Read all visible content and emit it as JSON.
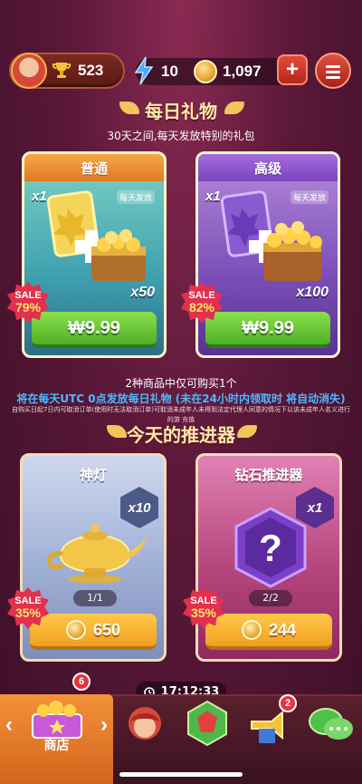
{
  "topbar": {
    "trophies": "523",
    "energy": "10",
    "coins": "1,097",
    "plus_label": "+"
  },
  "daily_gifts": {
    "title": "每日礼物",
    "subtitle": "30天之间,每天发放特别的礼包",
    "cards": [
      {
        "name": "普通",
        "qty_top": "x1",
        "tag": "每天发放",
        "qty_bottom": "x50",
        "price": "₩9.99",
        "sale_label": "SALE",
        "sale_pct": "79%"
      },
      {
        "name": "高级",
        "qty_top": "x1",
        "tag": "每天发放",
        "qty_bottom": "x100",
        "price": "₩9.99",
        "sale_label": "SALE",
        "sale_pct": "82%"
      }
    ],
    "note_limit": "2种商品中仅可购买1个",
    "note_timing": "将在每天UTC 0点发放每日礼物 (未在24小时内领取时 将自动消失)",
    "note_legal": "自购买日起7日内可取消订单(使用时无法取消订单)可取消未成年人未得到法定代理人同意的情况下以该未成年人名义进行的游 充值"
  },
  "boosters": {
    "title": "今天的推进器",
    "cards": [
      {
        "name": "神灯",
        "qty": "x10",
        "stock": "1/1",
        "price": "650",
        "sale_label": "SALE",
        "sale_pct": "35%"
      },
      {
        "name": "钻石推进器",
        "qty": "x1",
        "stock": "2/2",
        "price": "244",
        "sale_label": "SALE",
        "sale_pct": "35%"
      }
    ],
    "timer": "17:12:33"
  },
  "nav": {
    "shop_label": "商店",
    "shop_badge": "6",
    "events_badge": "2",
    "left_arrow": "‹",
    "right_arrow": "›"
  },
  "colors": {
    "accent_green": "#4fb028",
    "accent_gold": "#f0a020",
    "sale_red": "#e2304d",
    "nav_shop": "#e07a22"
  }
}
